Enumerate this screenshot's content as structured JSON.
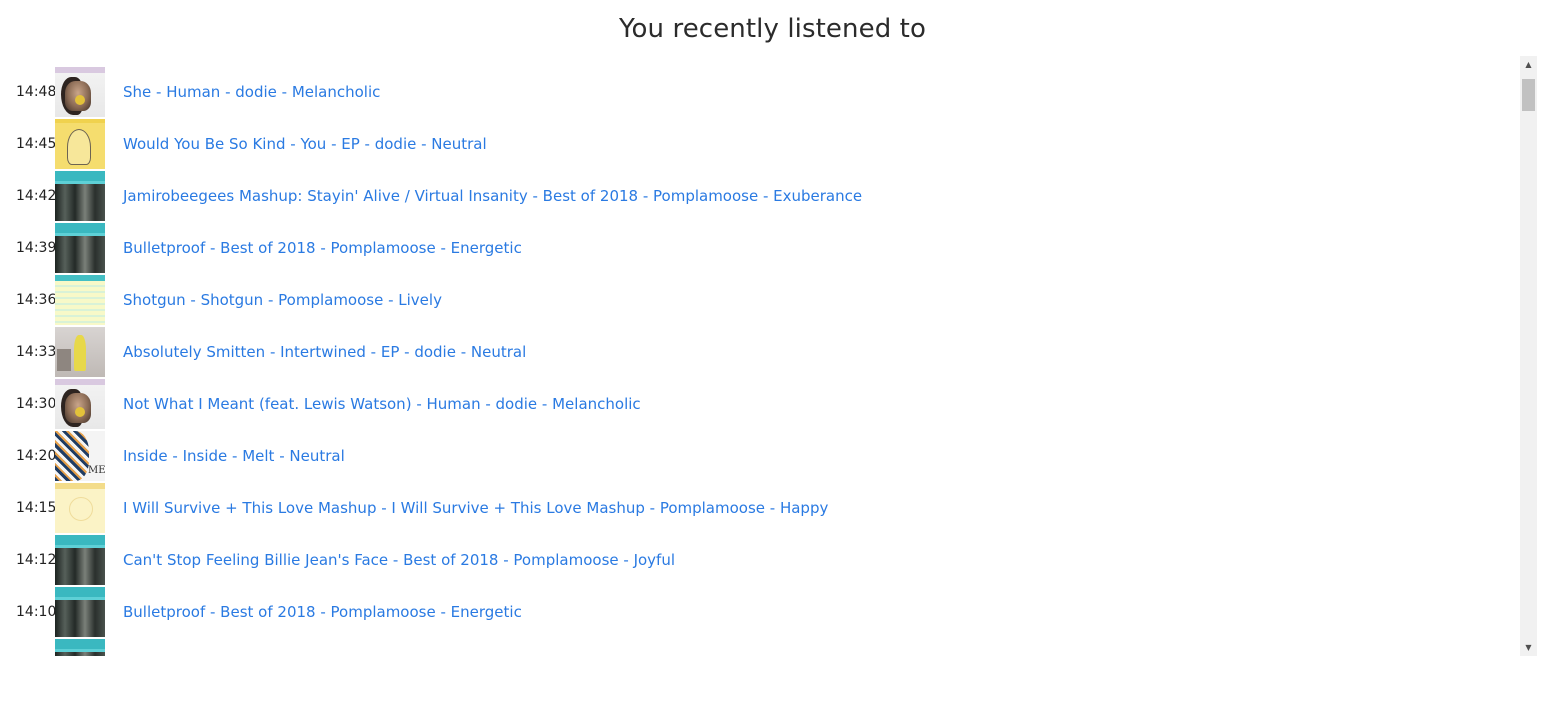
{
  "page": {
    "heading": "You recently listened to"
  },
  "tracks": [
    {
      "time": "14:48",
      "label": "She - Human - dodie - Melancholic",
      "cover": "human"
    },
    {
      "time": "14:45",
      "label": "Would You Be So Kind - You - EP - dodie - Neutral",
      "cover": "you"
    },
    {
      "time": "14:42",
      "label": "Jamirobeegees Mashup: Stayin' Alive / Virtual Insanity - Best of 2018 - Pomplamoose - Exuberance",
      "cover": "best"
    },
    {
      "time": "14:39",
      "label": "Bulletproof - Best of 2018 - Pomplamoose - Energetic",
      "cover": "best"
    },
    {
      "time": "14:36",
      "label": "Shotgun - Shotgun - Pomplamoose - Lively",
      "cover": "shotgun"
    },
    {
      "time": "14:33",
      "label": "Absolutely Smitten - Intertwined - EP - dodie - Neutral",
      "cover": "intertwined"
    },
    {
      "time": "14:30",
      "label": "Not What I Meant (feat. Lewis Watson) - Human - dodie - Melancholic",
      "cover": "human"
    },
    {
      "time": "14:20",
      "label": "Inside - Inside - Melt - Neutral",
      "cover": "melt"
    },
    {
      "time": "14:15",
      "label": "I Will Survive + This Love Mashup - I Will Survive + This Love Mashup - Pomplamoose - Happy",
      "cover": "survive"
    },
    {
      "time": "14:12",
      "label": "Can't Stop Feeling Billie Jean's Face - Best of 2018 - Pomplamoose - Joyful",
      "cover": "best"
    },
    {
      "time": "14:10",
      "label": "Bulletproof - Best of 2018 - Pomplamoose - Energetic",
      "cover": "best"
    },
    {
      "time": "",
      "label": "",
      "cover": "best"
    }
  ],
  "scrollbar": {
    "up_icon": "triangle-up-icon",
    "down_icon": "triangle-down-icon",
    "up_glyph": "▲",
    "down_glyph": "▼"
  },
  "colors": {
    "link": "#2a7ae2",
    "heading": "#2b2b2b",
    "time": "#222222"
  }
}
